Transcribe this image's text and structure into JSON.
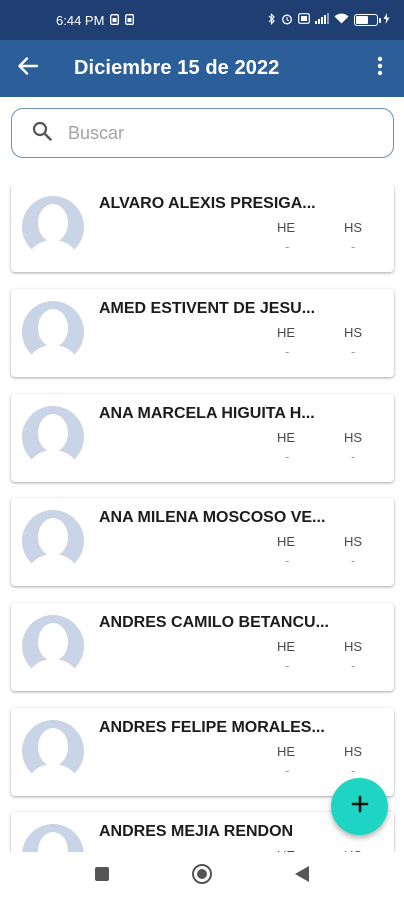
{
  "status_bar": {
    "time": "6:44 PM",
    "icons": [
      "sim-icon",
      "sim-icon",
      "bluetooth-icon",
      "alarm-icon",
      "data-icon",
      "signal-icon",
      "wifi-icon",
      "battery-icon",
      "charging-icon"
    ]
  },
  "app_bar": {
    "title": "Diciembre 15 de 2022",
    "back_icon": "arrow-back-icon",
    "menu_icon": "more-vert-icon"
  },
  "search": {
    "placeholder": "Buscar",
    "value": ""
  },
  "columns": {
    "he": "HE",
    "hs": "HS"
  },
  "employees": [
    {
      "name": "ALVARO ALEXIS PRESIGA...",
      "he": "-",
      "hs": "-"
    },
    {
      "name": "AMED ESTIVENT DE JESU...",
      "he": "-",
      "hs": "-"
    },
    {
      "name": "ANA MARCELA HIGUITA H...",
      "he": "-",
      "hs": "-"
    },
    {
      "name": "ANA MILENA MOSCOSO VE...",
      "he": "-",
      "hs": "-"
    },
    {
      "name": "ANDRES CAMILO BETANCU...",
      "he": "-",
      "hs": "-"
    },
    {
      "name": "ANDRES FELIPE MORALES...",
      "he": "-",
      "hs": "-"
    },
    {
      "name": "ANDRES MEJIA RENDON",
      "he": "-",
      "hs": "-"
    }
  ],
  "fab": {
    "label": "+",
    "icon": "add-icon"
  },
  "colors": {
    "status_bar": "#1f3f73",
    "app_bar": "#2c5f9a",
    "fab": "#1ed5c3",
    "avatar": "#c9d4e6"
  }
}
